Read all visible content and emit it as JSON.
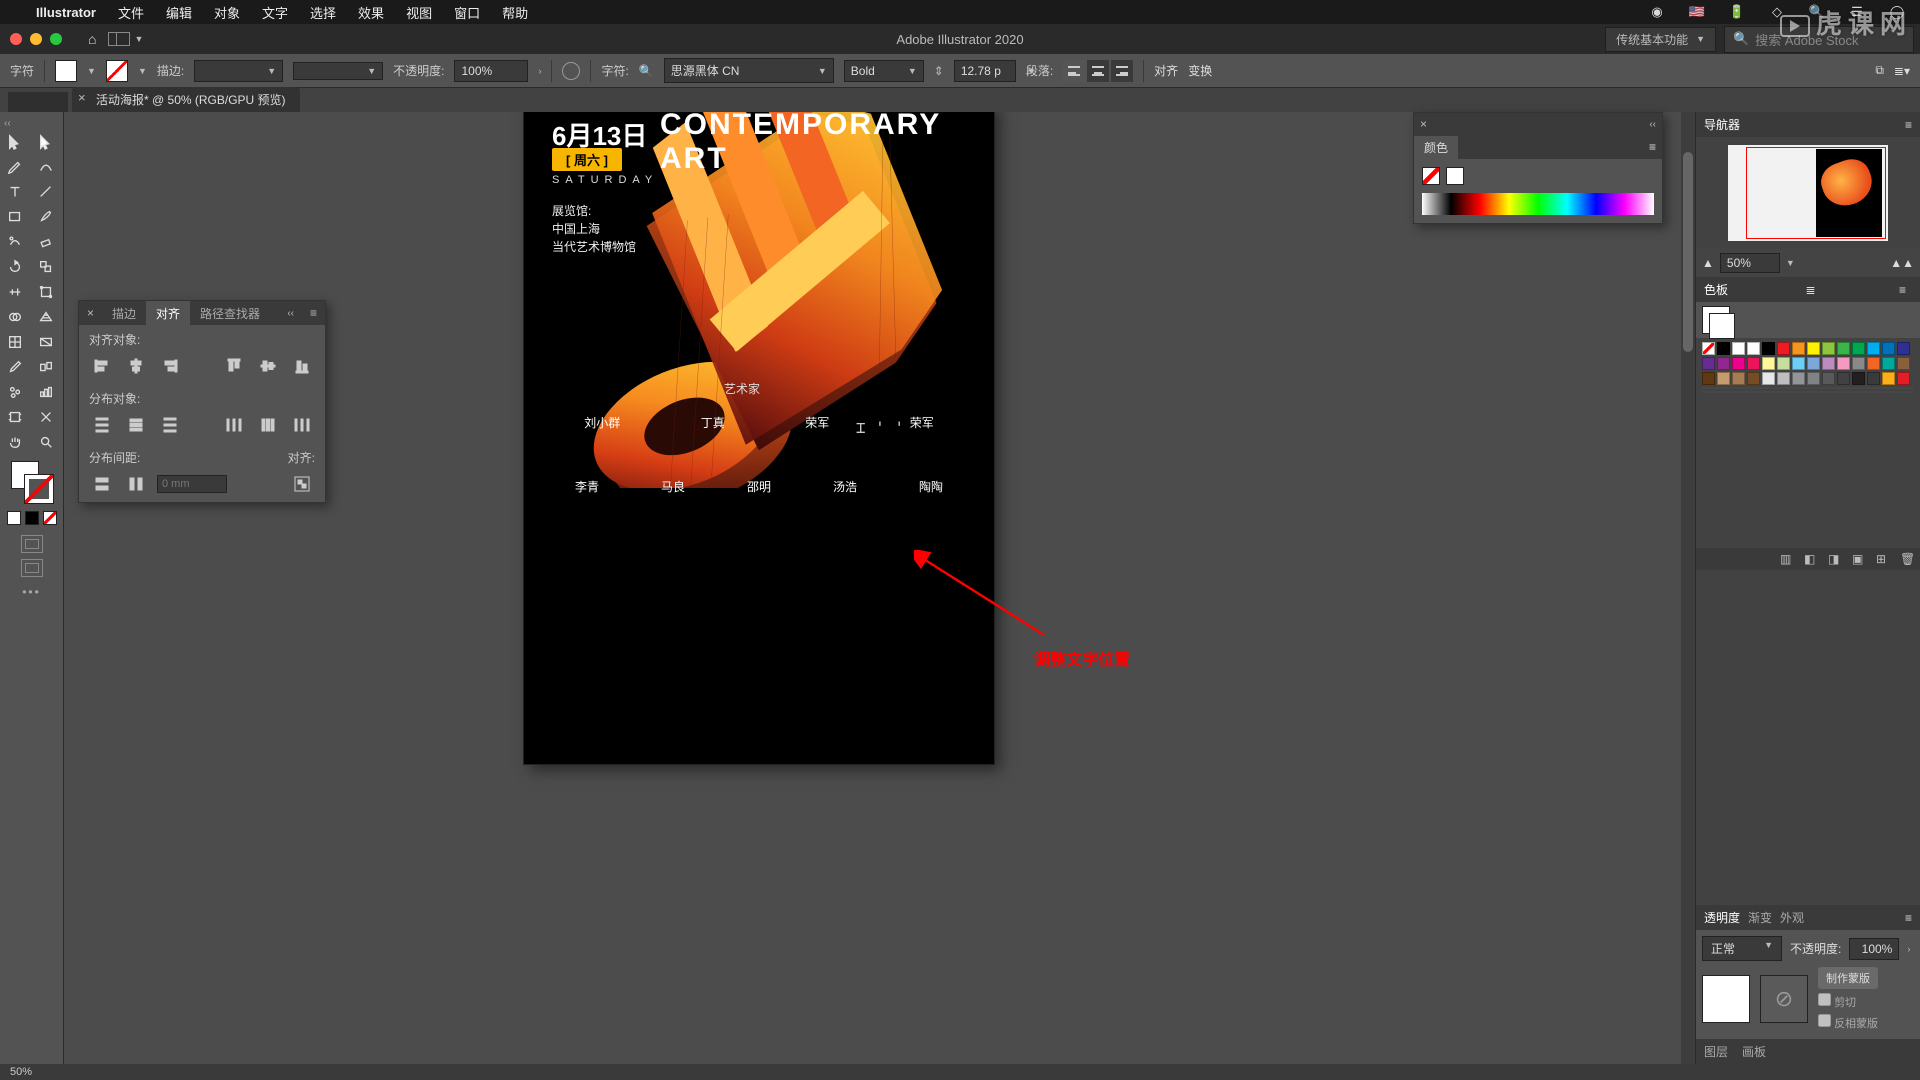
{
  "macmenu": {
    "app": "Illustrator",
    "items": [
      "文件",
      "编辑",
      "对象",
      "文字",
      "选择",
      "效果",
      "视图",
      "窗口",
      "帮助"
    ],
    "status": {
      "rec": "●",
      "flag": "🇺🇸",
      "batt": "🔋",
      "wifi": "📶"
    }
  },
  "titlebar": {
    "title": "Adobe Illustrator 2020",
    "workspace_label": "传统基本功能",
    "search_placeholder": "搜索 Adobe Stock"
  },
  "controlbar": {
    "panel": "字符",
    "stroke_label": "描边:",
    "opacity_label": "不透明度:",
    "opacity_value": "100%",
    "char_label": "字符:",
    "font_family": "思源黑体 CN",
    "font_style": "Bold",
    "font_size": "12.78 p",
    "para_label": "段落:",
    "align_label": "对齐",
    "transform_label": "变换"
  },
  "tab": {
    "name": "活动海报* @ 50% (RGB/GPU 预览)"
  },
  "tools": [
    "selection",
    "direct-selection",
    "pen",
    "curvature",
    "type",
    "line",
    "rectangle",
    "paintbrush",
    "shaper",
    "eraser",
    "rotate",
    "scale",
    "width",
    "free-transform",
    "shape-builder",
    "perspective",
    "mesh",
    "gradient",
    "eyedropper",
    "blend",
    "symbol-sprayer",
    "column-graph",
    "artboard",
    "slice",
    "hand",
    "zoom"
  ],
  "align_panel": {
    "tabs": [
      "描边",
      "对齐",
      "路径查找器"
    ],
    "active_tab": 1,
    "section_align": "对齐对象:",
    "section_dist": "分布对象:",
    "section_spacing": "分布间距:",
    "align_to": "对齐:",
    "spacing_value": "0 mm"
  },
  "color_panel": {
    "title": "颜色"
  },
  "artboard": {
    "date": "6月13日",
    "day": "周六",
    "dow": "SATURDAY",
    "title1": "CONTEMPORARY",
    "title2": "ART",
    "venue_label": "展览馆:",
    "venue_line1": "中国上海",
    "venue_line2": "当代艺术博物馆",
    "section_label": "艺术家",
    "names_row1": [
      "刘小群",
      "丁真",
      "荣军",
      "荣军"
    ],
    "names_row2": [
      "李青",
      "马良",
      "邵明",
      "汤浩",
      "陶陶"
    ],
    "cursor": "⌶ ' '"
  },
  "annotation": "调整文字位置",
  "right": {
    "nav": {
      "title": "导航器",
      "zoom": "50%"
    },
    "swatches": {
      "title": "色板",
      "colors": [
        "#ffffff",
        "#000000",
        "#ed1c24",
        "#f7941d",
        "#fff200",
        "#8dc63e",
        "#39b54a",
        "#00a651",
        "#00aeef",
        "#0072bc",
        "#2e3192",
        "#662d91",
        "#92278f",
        "#ec008c",
        "#ed145b",
        "#fff799",
        "#c4df9b",
        "#6dcff6",
        "#7da7d9",
        "#bd8cbf",
        "#f49ac1",
        "#898989",
        "#f26522",
        "#00a99d",
        "#8b5e3c",
        "#603913",
        "#c69c6d",
        "#a67c52",
        "#754c24",
        "#e6e7e8",
        "#bcbec0",
        "#939598",
        "#808285",
        "#58595b",
        "#414042",
        "#231f20",
        "#3a3a3a",
        "#fcaf17",
        "#e41e26"
      ]
    },
    "transparency": {
      "tabs": [
        "透明度",
        "渐变",
        "外观"
      ],
      "active": 0,
      "mode": "正常",
      "opacity_label": "不透明度:",
      "opacity": "100%",
      "make_mask": "制作蒙版",
      "clip": "剪切",
      "invert": "反相蒙版"
    },
    "layertabs": [
      "图层",
      "画板"
    ]
  },
  "status": {
    "zoom": "50%"
  },
  "watermark": "虎课网"
}
